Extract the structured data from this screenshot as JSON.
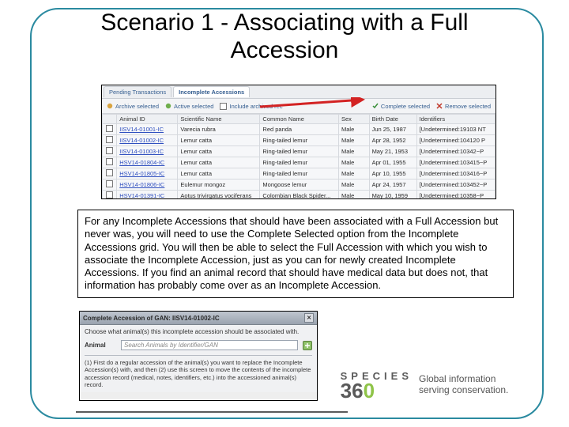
{
  "title": "Scenario 1 - Associating with a Full Accession",
  "top_grid": {
    "tabs": [
      {
        "label": "Pending Transactions"
      },
      {
        "label": "Incomplete Accessions"
      }
    ],
    "toolbar": {
      "archive": "Archive selected",
      "active": "Active selected",
      "include_archived": "Include archived rec",
      "complete": "Complete selected",
      "remove": "Remove selected"
    },
    "headers": {
      "animal_id": "Animal ID",
      "scientific": "Scientific Name",
      "common": "Common Name",
      "sex": "Sex",
      "birth": "Birth Date",
      "identifiers": "Identifiers"
    },
    "rows": [
      {
        "id": "IISV14-01001-IC",
        "sci": "Varecia rubra",
        "com": "Red panda",
        "sex": "Male",
        "dob": "Jun 25, 1987",
        "ident": "[Undetermined:19103 NT"
      },
      {
        "id": "IISV14-01002-IC",
        "sci": "Lemur catta",
        "com": "Ring-tailed lemur",
        "sex": "Male",
        "dob": "Apr 28, 1952",
        "ident": "[Undetermined:104120 P"
      },
      {
        "id": "IISV14-01003-IC",
        "sci": "Lemur catta",
        "com": "Ring-tailed lemur",
        "sex": "Male",
        "dob": "May 21, 1953",
        "ident": "[Undetermined:10342~P"
      },
      {
        "id": "HSV14-01804-IC",
        "sci": "Lemur catta",
        "com": "Ring-tailed lemur",
        "sex": "Male",
        "dob": "Apr 01, 1955",
        "ident": "[Undetermined:103415~P"
      },
      {
        "id": "HSV14-01805-IC",
        "sci": "Lemur catta",
        "com": "Ring-tailed lemur",
        "sex": "Male",
        "dob": "Apr 10, 1955",
        "ident": "[Undetermined:103416~P"
      },
      {
        "id": "HSV14-01806-IC",
        "sci": "Eulemur mongoz",
        "com": "Mongoose lemur",
        "sex": "Male",
        "dob": "Apr 24, 1957",
        "ident": "[Undetermined:103452~P"
      },
      {
        "id": "HSV14-01391-IC",
        "sci": "Aotus trivirgatus vociferans",
        "com": "Colombian Black Spider...",
        "sex": "Male",
        "dob": "May 10, 1959",
        "ident": "[Undetermined:10358~P"
      }
    ]
  },
  "instruction": "For any Incomplete Accessions that should have been associated with a Full Accession but never was, you will need to use the Complete Selected option from the Incomplete Accessions grid. You will then be able to select the Full Accession with which you wish to associate the Incomplete Accession, just as you can for newly created Incomplete Accessions. If you find an animal record that should have medical data but does not, that information has probably come over as an Incomplete Accession.",
  "modal": {
    "title": "Complete Accession of GAN: IISV14-01002-IC",
    "prompt": "Choose what animal(s) this incomplete accession should be associated with.",
    "animal_label": "Animal",
    "animal_placeholder": "Search Animals by Identifier/GAN",
    "note": "(1) First do a regular accession of the animal(s) you want to replace the Incomplete Accession(s) with, and then (2) use this screen to move the contents of the incomplete accession record (medical, notes, identifiers, etc.) into the accessioned animal(s) record."
  },
  "logo": {
    "line1": "SPECIES",
    "line2_a": "36",
    "line2_b": "0",
    "tagline": "Global information serving conservation."
  }
}
